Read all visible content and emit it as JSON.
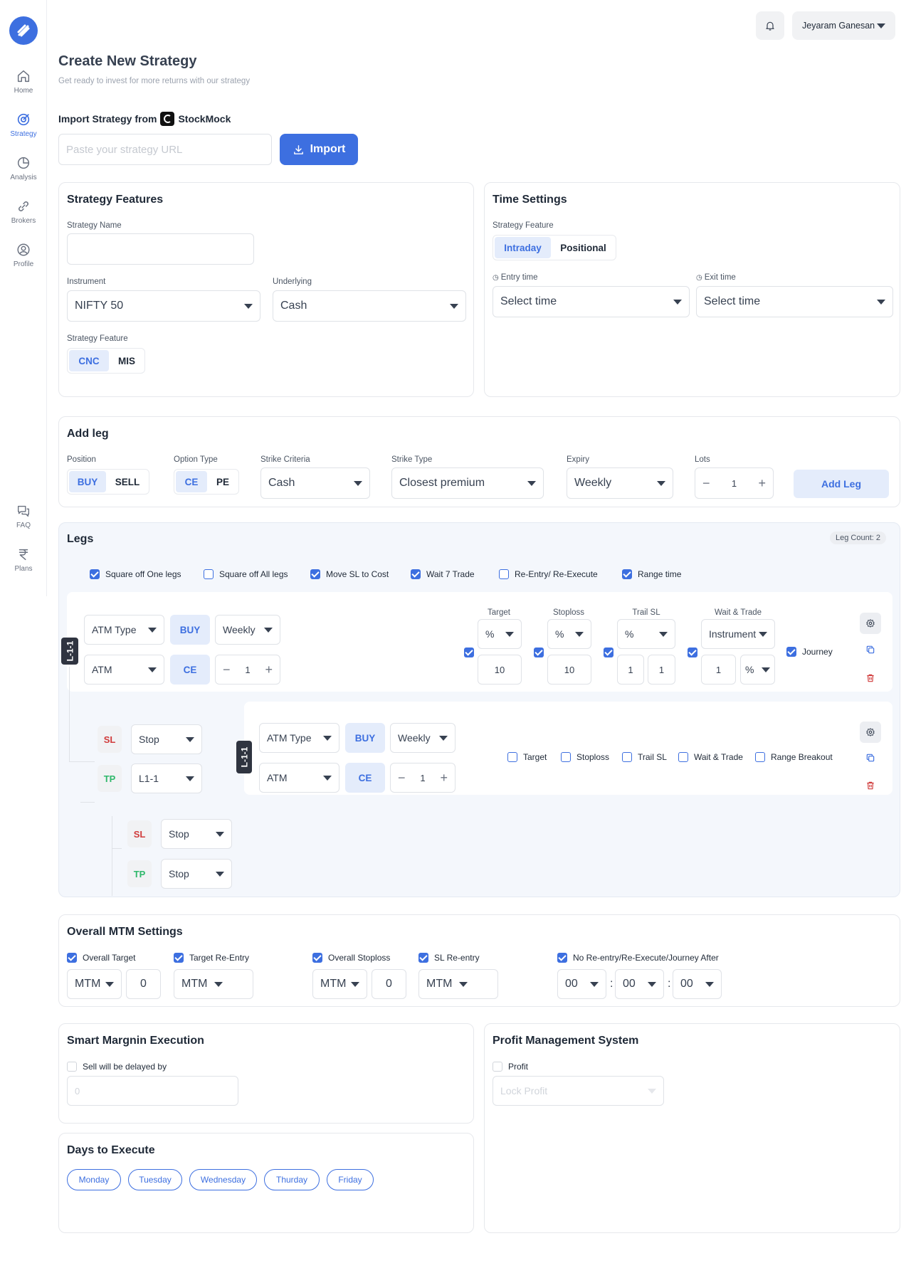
{
  "nav": {
    "items": [
      {
        "label": "Home"
      },
      {
        "label": "Strategy"
      },
      {
        "label": "Analysis"
      },
      {
        "label": "Brokers"
      },
      {
        "label": "Profile"
      },
      {
        "label": "FAQ"
      },
      {
        "label": "Plans"
      }
    ]
  },
  "header": {
    "user_name": "Jeyaram Ganesan"
  },
  "page": {
    "title": "Create New Strategy",
    "subtitle": "Get ready to invest for more returns with our strategy"
  },
  "import": {
    "label": "Import Strategy from",
    "brand": "StockMock",
    "placeholder": "Paste your strategy URL",
    "button": "Import"
  },
  "features": {
    "title": "Strategy Features",
    "name_label": "Strategy Name",
    "instrument_label": "Instrument",
    "instrument_value": "NIFTY 50",
    "underlying_label": "Underlying",
    "underlying_value": "Cash",
    "feature_label": "Strategy Feature",
    "opt_cnc": "CNC",
    "opt_mis": "MIS"
  },
  "time": {
    "title": "Time Settings",
    "feature_label": "Strategy Feature",
    "opt_intraday": "Intraday",
    "opt_positional": "Positional",
    "entry_label": "Entry time",
    "exit_label": "Exit time",
    "entry_value": "Select time",
    "exit_value": "Select time"
  },
  "addleg": {
    "title": "Add leg",
    "position_label": "Position",
    "buy": "BUY",
    "sell": "SELL",
    "option_label": "Option Type",
    "ce": "CE",
    "pe": "PE",
    "strike_criteria_label": "Strike Criteria",
    "strike_criteria_value": "Cash",
    "strike_type_label": "Strike Type",
    "strike_type_value": "Closest premium",
    "expiry_label": "Expiry",
    "expiry_value": "Weekly",
    "lots_label": "Lots",
    "lots_value": "1",
    "button": "Add Leg"
  },
  "legs": {
    "title": "Legs",
    "count": "Leg Count: 2",
    "options": [
      {
        "label": "Square off One legs",
        "checked": true
      },
      {
        "label": "Square off All legs",
        "checked": false
      },
      {
        "label": "Move SL to Cost",
        "checked": true
      },
      {
        "label": "Wait 7 Trade",
        "checked": true
      },
      {
        "label": "Re-Entry/ Re-Execute",
        "checked": false
      },
      {
        "label": "Range time",
        "checked": true
      }
    ],
    "leg1": {
      "tag": "L-1-1",
      "atm_type": "ATM Type",
      "buy": "BUY",
      "expiry": "Weekly",
      "atm": "ATM",
      "ce": "CE",
      "qty": "1",
      "target_label": "Target",
      "target_unit": "%",
      "target_value": "10",
      "stoploss_label": "Stoploss",
      "stoploss_unit": "%",
      "stoploss_value": "10",
      "trail_label": "Trail SL",
      "trail_unit": "%",
      "trail_v1": "1",
      "trail_v2": "1",
      "wait_label": "Wait & Trade",
      "wait_unit": "Instrument",
      "wait_value": "1",
      "wait_unit2": "%",
      "journey": "Journey"
    },
    "sub": {
      "sl": "SL",
      "tp": "TP",
      "sl_value": "Stop",
      "tp_value": "L1-1",
      "tag": "L-1-1",
      "atm_type": "ATM Type",
      "buy": "BUY",
      "expiry": "Weekly",
      "atm": "ATM",
      "ce": "CE",
      "qty": "1",
      "checks": [
        "Target",
        "Stoploss",
        "Trail SL",
        "Wait & Trade",
        "Range Breakout"
      ]
    },
    "sub2": {
      "sl": "SL",
      "tp": "TP",
      "sl_value": "Stop",
      "tp_value": "Stop"
    }
  },
  "mtm": {
    "title": "Overall MTM Settings",
    "overall_target": "Overall Target",
    "target_reentry": "Target Re-Entry",
    "overall_stoploss": "Overall Stoploss",
    "sl_reentry": "SL Re-entry",
    "no_reentry": "No Re-entry/Re-Execute/Journey After",
    "mtm": "MTM",
    "zero": "0",
    "hh": "00",
    "mm": "00",
    "ss": "00",
    "colon": ":"
  },
  "smart": {
    "title": "Smart Margnin Execution",
    "check_label": "Sell will be delayed by",
    "placeholder": "0"
  },
  "profit": {
    "title": "Profit Management System",
    "check_label": "Profit",
    "placeholder": "Lock Profit"
  },
  "days": {
    "title": "Days to Execute",
    "items": [
      "Monday",
      "Tuesday",
      "Wednesday",
      "Thurday",
      "Friday"
    ]
  },
  "colors": {
    "accent": "#3d6fe0",
    "sl": "#d03b3b",
    "tp": "#2fb86b"
  }
}
